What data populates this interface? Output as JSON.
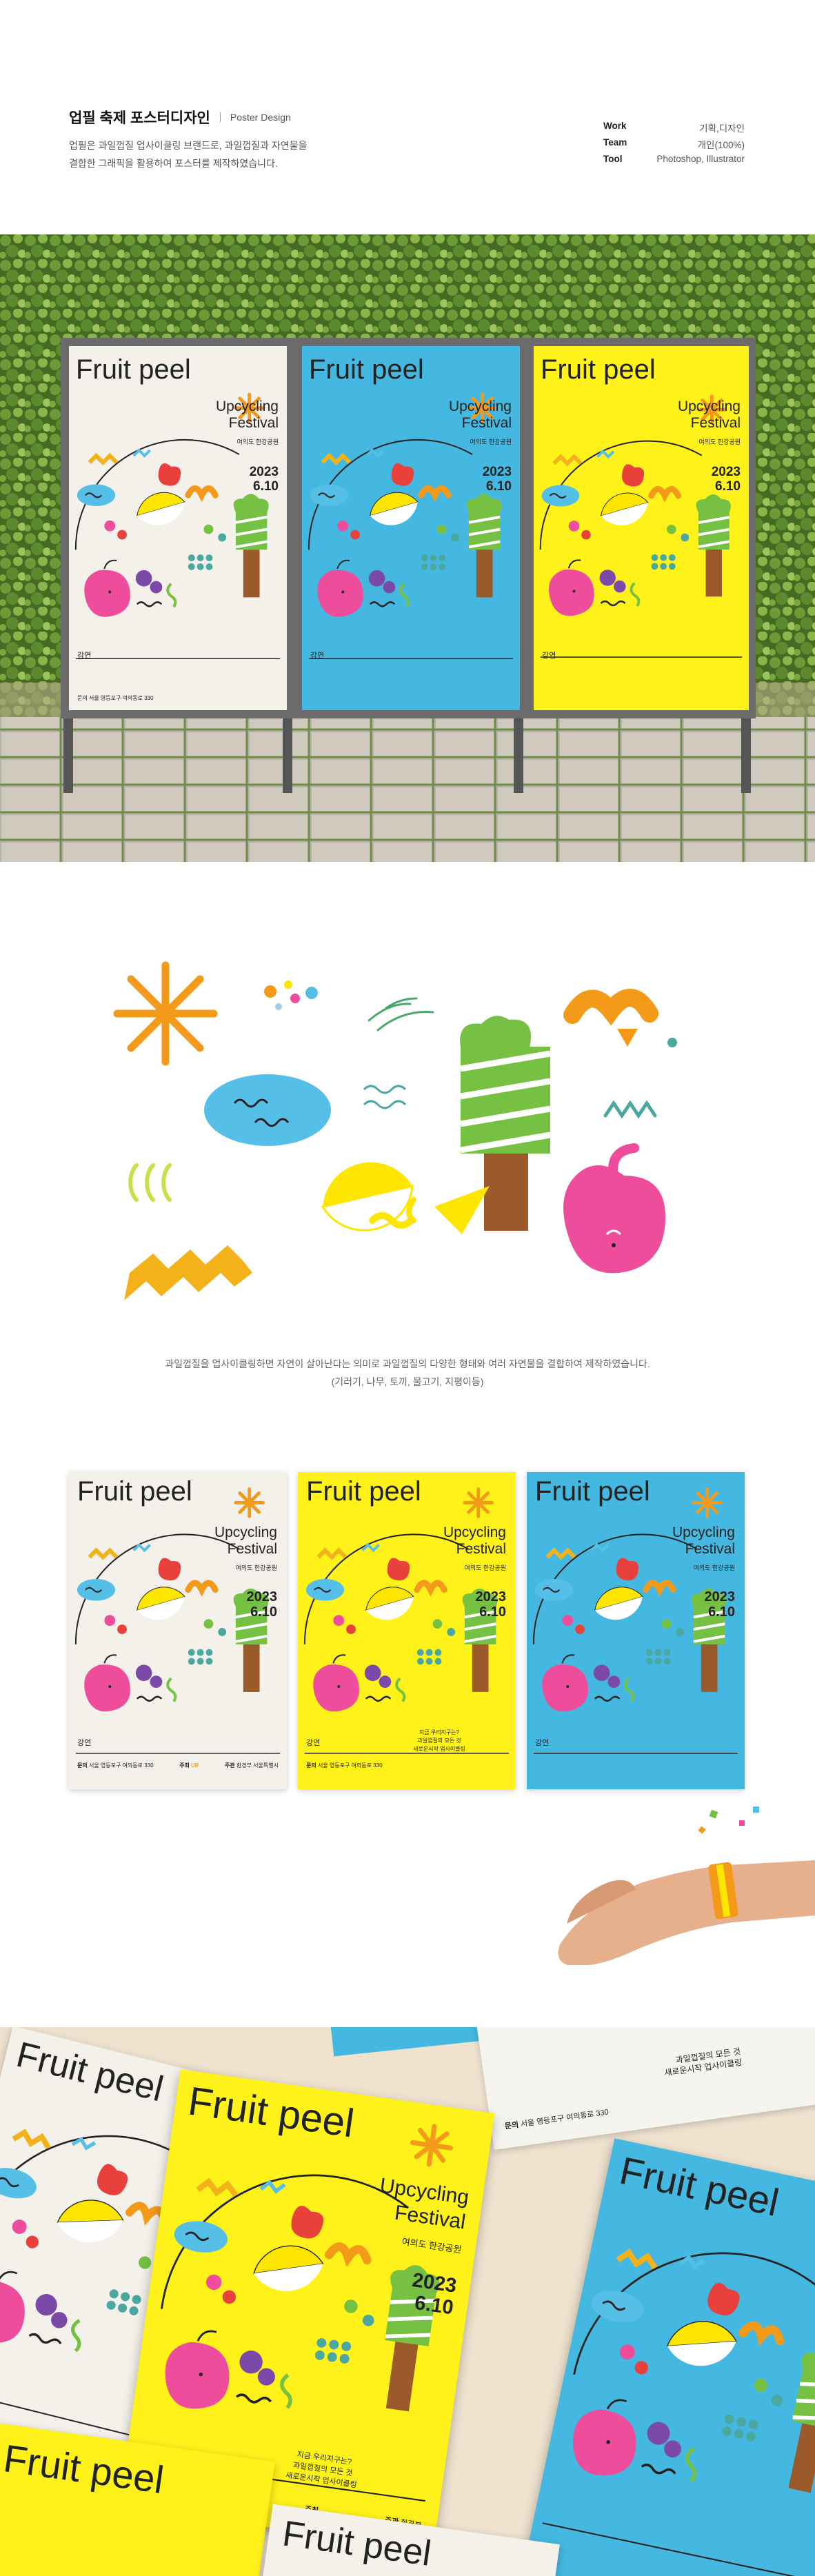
{
  "header": {
    "title_kr": "업필 축제 포스터디자인",
    "title_en": "Poster Design",
    "desc_line1": "업필은 과일껍질 업사이클링 브랜드로, 과일껍질과 자연물을",
    "desc_line2": "결합한 그래픽을 활용하여 포스터를 제작하였습니다.",
    "meta": [
      {
        "key": "Work",
        "value": "기획,디자인"
      },
      {
        "key": "Team",
        "value": "개인(100%)"
      },
      {
        "key": "Tool",
        "value": "Photoshop, Illustrator"
      }
    ]
  },
  "poster": {
    "title": "Fruit peel",
    "subtitle1": "Upcycling",
    "subtitle2": "Festival",
    "venue": "여의도 한강공원",
    "year": "2023",
    "date": "6.10",
    "lecture": "강연",
    "q1": "지금 우리지구는?",
    "q2": "과일껍질의 모든 것",
    "q3": "새로운시작 업사이클링",
    "host_label": "문의",
    "host_addr": "서울 영등포구 여의동로 330",
    "org_label": "주최",
    "org_logo": "UP",
    "sponsor_label": "주관",
    "sponsor1": "환경부",
    "sponsor2": "서울특별시"
  },
  "elements": {
    "caption_line1": "과일껍질을 업사이클링하면 자연이 살아난다는 의미로 과일껍질의 다양한 형태와 여러 자연물을 결합하여 제작하였습니다.",
    "caption_line2": "(기러기, 나무, 토끼, 물고기, 지평이등)"
  },
  "colors": {
    "poster_white": "#f4f1ea",
    "poster_blue": "#44b8e0",
    "poster_yellow": "#fff11a",
    "orange": "#f39a1a",
    "green": "#76c043",
    "pink": "#ee4d9b",
    "red": "#e8403a",
    "sky": "#56bfe8",
    "brown": "#9a5a2a",
    "yellow": "#ffe600",
    "teal": "#4aa8a0"
  }
}
